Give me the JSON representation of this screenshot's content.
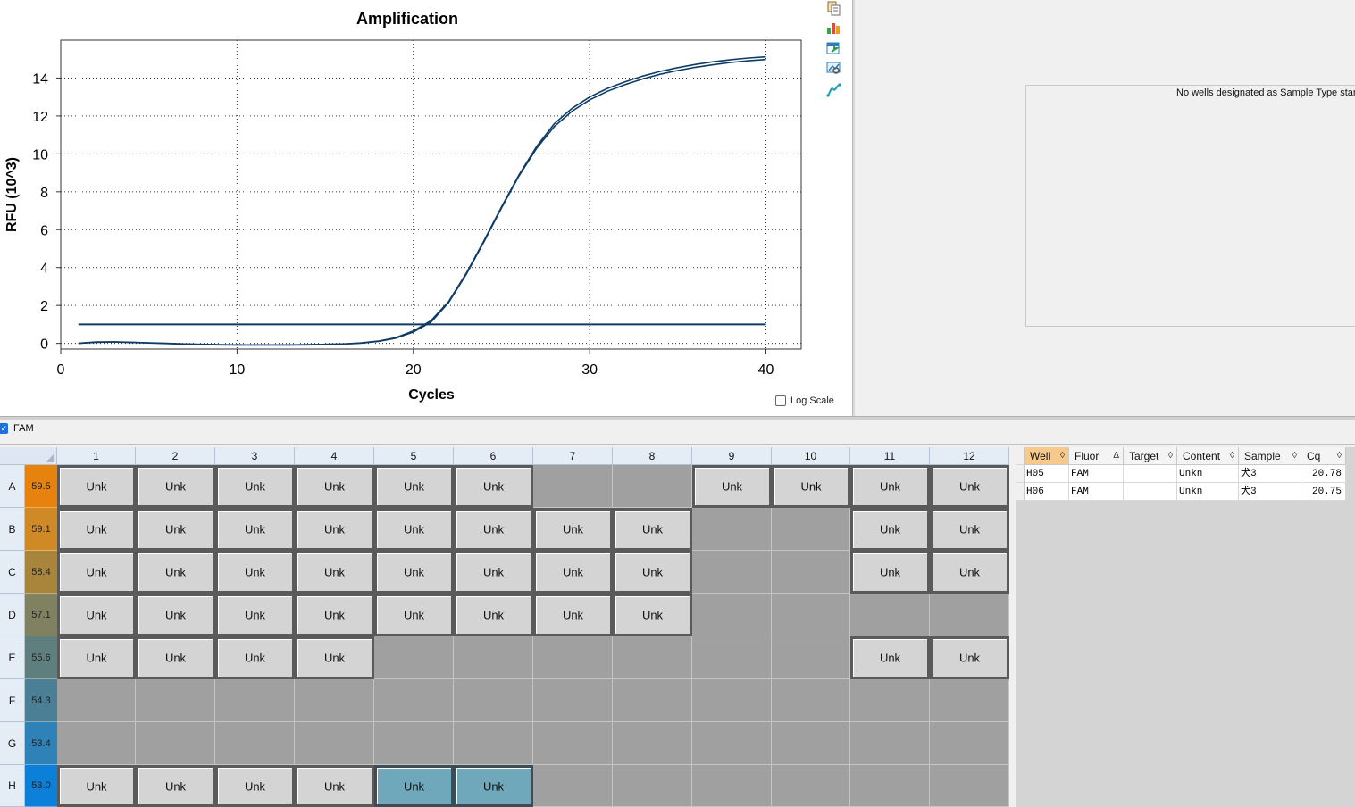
{
  "chart": {
    "title": "Amplification",
    "xlabel": "Cycles",
    "ylabel": "RFU (10^3)",
    "log_scale_label": "Log Scale",
    "log_scale_checked": false,
    "line_color": "#0e3b66"
  },
  "chart_data": {
    "type": "line",
    "title": "Amplification",
    "xlabel": "Cycles",
    "ylabel": "RFU (10^3)",
    "xlim": [
      0,
      42
    ],
    "ylim": [
      -0.3,
      16
    ],
    "x_ticks": [
      0,
      10,
      20,
      30,
      40
    ],
    "y_ticks": [
      0,
      2,
      4,
      6,
      8,
      10,
      12,
      14
    ],
    "grid": true,
    "threshold": 1.0,
    "x": [
      1,
      2,
      3,
      4,
      5,
      6,
      7,
      8,
      9,
      10,
      11,
      12,
      13,
      14,
      15,
      16,
      17,
      18,
      19,
      20,
      21,
      22,
      23,
      24,
      25,
      26,
      27,
      28,
      29,
      30,
      31,
      32,
      33,
      34,
      35,
      36,
      37,
      38,
      39,
      40
    ],
    "series": [
      {
        "values": [
          0.0,
          0.07,
          0.08,
          0.06,
          0.03,
          0.0,
          -0.03,
          -0.05,
          -0.07,
          -0.08,
          -0.08,
          -0.08,
          -0.08,
          -0.07,
          -0.05,
          -0.03,
          0.02,
          0.12,
          0.3,
          0.65,
          1.2,
          2.2,
          3.7,
          5.4,
          7.2,
          8.9,
          10.4,
          11.6,
          12.4,
          13.0,
          13.45,
          13.8,
          14.1,
          14.35,
          14.55,
          14.72,
          14.86,
          14.97,
          15.06,
          15.12
        ]
      },
      {
        "values": [
          0.0,
          0.06,
          0.07,
          0.05,
          0.02,
          -0.01,
          -0.04,
          -0.06,
          -0.08,
          -0.09,
          -0.09,
          -0.09,
          -0.09,
          -0.08,
          -0.06,
          -0.04,
          0.01,
          0.1,
          0.27,
          0.6,
          1.12,
          2.15,
          3.65,
          5.35,
          7.15,
          8.85,
          10.3,
          11.45,
          12.25,
          12.85,
          13.3,
          13.65,
          13.95,
          14.2,
          14.4,
          14.57,
          14.7,
          14.82,
          14.91,
          14.98
        ]
      }
    ]
  },
  "fluor": {
    "label": "FAM",
    "checked": true
  },
  "plate": {
    "columns": [
      "1",
      "2",
      "3",
      "4",
      "5",
      "6",
      "7",
      "8",
      "9",
      "10",
      "11",
      "12"
    ],
    "rows": [
      {
        "label": "A",
        "temp": "59.5",
        "color": "#e8820e",
        "wells": [
          "Unk",
          "Unk",
          "Unk",
          "Unk",
          "Unk",
          "Unk",
          "",
          "",
          "Unk",
          "Unk",
          "Unk",
          "Unk"
        ]
      },
      {
        "label": "B",
        "temp": "59.1",
        "color": "#cf8a26",
        "wells": [
          "Unk",
          "Unk",
          "Unk",
          "Unk",
          "Unk",
          "Unk",
          "Unk",
          "Unk",
          "",
          "",
          "Unk",
          "Unk"
        ]
      },
      {
        "label": "C",
        "temp": "58.4",
        "color": "#a9853c",
        "wells": [
          "Unk",
          "Unk",
          "Unk",
          "Unk",
          "Unk",
          "Unk",
          "Unk",
          "Unk",
          "",
          "",
          "Unk",
          "Unk"
        ]
      },
      {
        "label": "D",
        "temp": "57.1",
        "color": "#7f8160",
        "wells": [
          "Unk",
          "Unk",
          "Unk",
          "Unk",
          "Unk",
          "Unk",
          "Unk",
          "Unk",
          "",
          "",
          "",
          ""
        ]
      },
      {
        "label": "E",
        "temp": "55.6",
        "color": "#5e7f7d",
        "wells": [
          "Unk",
          "Unk",
          "Unk",
          "Unk",
          "",
          "",
          "",
          "",
          "",
          "",
          "Unk",
          "Unk"
        ]
      },
      {
        "label": "F",
        "temp": "54.3",
        "color": "#4a7f96",
        "wells": [
          "",
          "",
          "",
          "",
          "",
          "",
          "",
          "",
          "",
          "",
          "",
          ""
        ]
      },
      {
        "label": "G",
        "temp": "53.4",
        "color": "#2f82b8",
        "wells": [
          "",
          "",
          "",
          "",
          "",
          "",
          "",
          "",
          "",
          "",
          "",
          ""
        ]
      },
      {
        "label": "H",
        "temp": "53.0",
        "color": "#0c7fd8",
        "wells": [
          "Unk",
          "Unk",
          "Unk",
          "Unk",
          "Unk",
          "Unk",
          "",
          "",
          "",
          "",
          "",
          ""
        ],
        "selected": [
          4,
          5
        ]
      }
    ]
  },
  "std_curve": {
    "message": "No wells designated as Sample Type stand"
  },
  "results": {
    "headers": [
      {
        "label": "Well",
        "sort": "◊"
      },
      {
        "label": "Fluor",
        "sort": "Δ"
      },
      {
        "label": "Target",
        "sort": "◊"
      },
      {
        "label": "Content",
        "sort": "◊"
      },
      {
        "label": "Sample",
        "sort": "◊"
      },
      {
        "label": "Cq",
        "sort": "◊"
      }
    ],
    "rows": [
      [
        "H05",
        "FAM",
        "",
        "Unkn",
        "犬3",
        "20.78"
      ],
      [
        "H06",
        "FAM",
        "",
        "Unkn",
        "犬3",
        "20.75"
      ]
    ]
  }
}
